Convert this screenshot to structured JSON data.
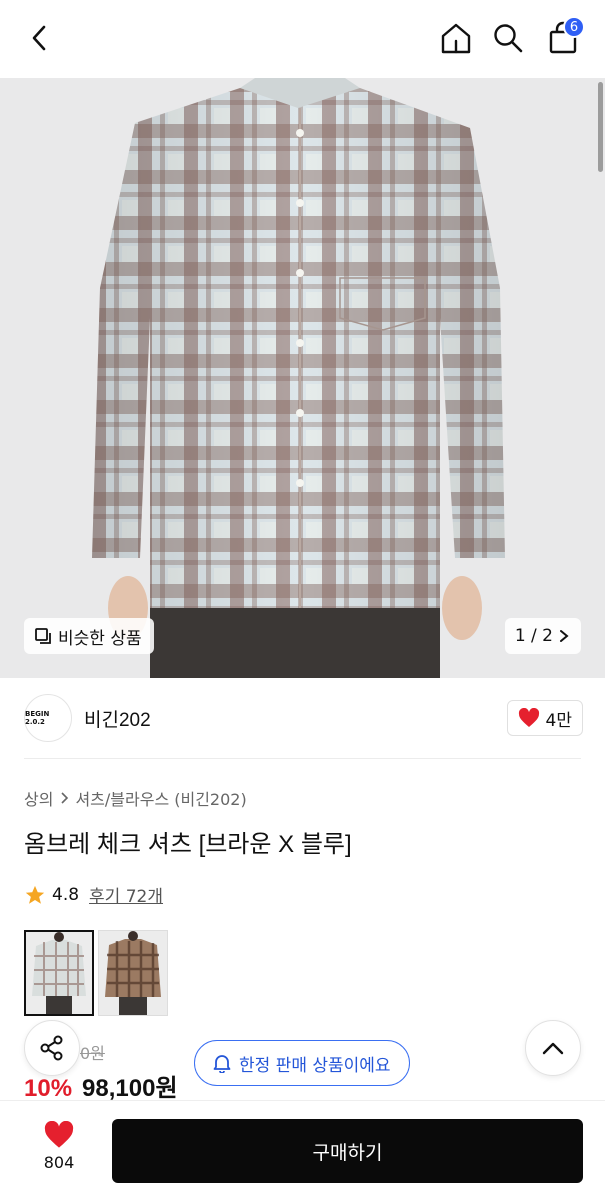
{
  "header": {
    "cart_count": "6"
  },
  "hero": {
    "similar_label": "비슷한 상품",
    "pager": "1 / 2"
  },
  "brand": {
    "logo_text": "BEGIN 2.0.2",
    "name": "비긴202",
    "likes": "4만"
  },
  "product": {
    "breadcrumb_category": "상의",
    "breadcrumb_sub": "셔츠/블라우스 (비긴202)",
    "title": "옴브레 체크 셔츠 [브라운 X 블루]",
    "rating": "4.8",
    "reviews": "후기 72개",
    "original_price_partial": "0원",
    "discount": "10%",
    "price": "98,100원"
  },
  "limited_label": "한정 판매 상품이에요",
  "bottom": {
    "wish_count": "804",
    "buy_label": "구매하기"
  },
  "colors": {
    "accent_blue": "#3a6ff2",
    "sale_red": "#e11d2b",
    "heart_red": "#e5202e",
    "star": "#f5a623"
  }
}
